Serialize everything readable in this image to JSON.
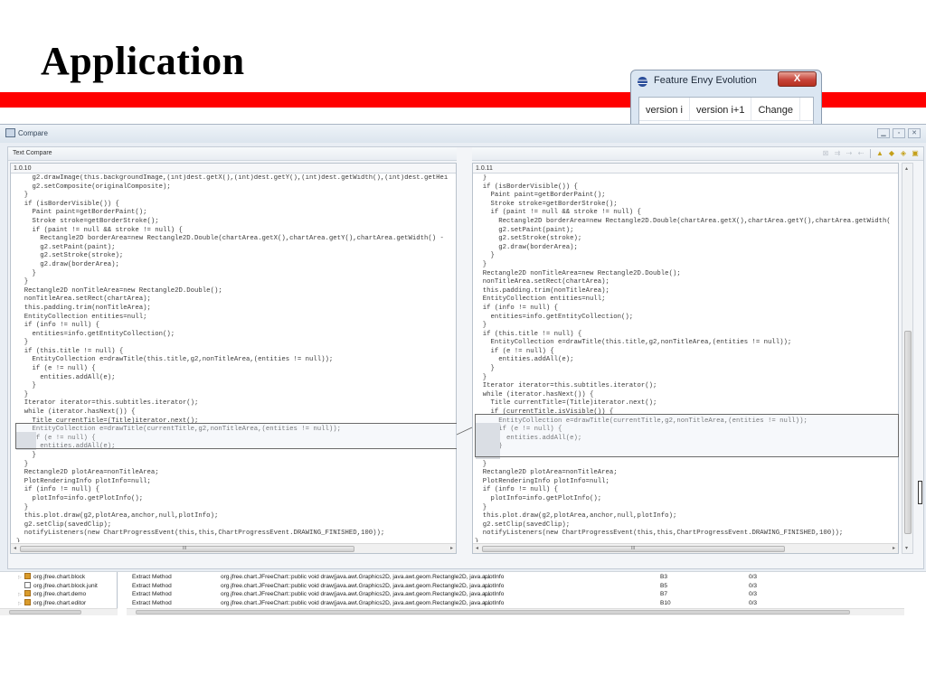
{
  "slide": {
    "title": "Application",
    "accent_color": "#ff0000"
  },
  "feature_envy_window": {
    "title": "Feature Envy Evolution",
    "close_label": "X",
    "columns": [
      "version i",
      "version i+1",
      "Change"
    ]
  },
  "compare_window": {
    "title": "Compare",
    "window_buttons": [
      "minimize",
      "maximize",
      "close"
    ],
    "panel_title": "Text Compare",
    "toolbar_icons": [
      "ignore-whitespace-icon",
      "copy-all-left-icon",
      "copy-right-icon",
      "copy-left-icon",
      "next-difference-icon",
      "previous-difference-icon",
      "next-change-icon",
      "previous-change-icon"
    ],
    "left": {
      "version": "1.0.10",
      "lines": [
        "    g2.drawImage(this.backgroundImage,(int)dest.getX(),(int)dest.getY(),(int)dest.getWidth(),(int)dest.getHei",
        "    g2.setComposite(originalComposite);",
        "  }",
        "  if (isBorderVisible()) {",
        "    Paint paint=getBorderPaint();",
        "    Stroke stroke=getBorderStroke();",
        "    if (paint != null && stroke != null) {",
        "      Rectangle2D borderArea=new Rectangle2D.Double(chartArea.getX(),chartArea.getY(),chartArea.getWidth() -",
        "      g2.setPaint(paint);",
        "      g2.setStroke(stroke);",
        "      g2.draw(borderArea);",
        "    }",
        "  }",
        "  Rectangle2D nonTitleArea=new Rectangle2D.Double();",
        "  nonTitleArea.setRect(chartArea);",
        "  this.padding.trim(nonTitleArea);",
        "  EntityCollection entities=null;",
        "  if (info != null) {",
        "    entities=info.getEntityCollection();",
        "  }",
        "  if (this.title != null) {",
        "    EntityCollection e=drawTitle(this.title,g2,nonTitleArea,(entities != null));",
        "    if (e != null) {",
        "      entities.addAll(e);",
        "    }",
        "  }",
        "  Iterator iterator=this.subtitles.iterator();",
        "  while (iterator.hasNext()) {",
        "    Title currentTitle=(Title)iterator.next();",
        "    EntityCollection e=drawTitle(currentTitle,g2,nonTitleArea,(entities != null));",
        "    if (e != null) {",
        "      entities.addAll(e);",
        "    }",
        "  }",
        "  Rectangle2D plotArea=nonTitleArea;",
        "  PlotRenderingInfo plotInfo=null;",
        "  if (info != null) {",
        "    plotInfo=info.getPlotInfo();",
        "  }",
        "  this.plot.draw(g2,plotArea,anchor,null,plotInfo);",
        "  g2.setClip(savedClip);",
        "  notifyListeners(new ChartProgressEvent(this,this,ChartProgressEvent.DRAWING_FINISHED,100));",
        "}"
      ]
    },
    "right": {
      "version": "1.0.11",
      "lines": [
        "  }",
        "  if (isBorderVisible()) {",
        "    Paint paint=getBorderPaint();",
        "    Stroke stroke=getBorderStroke();",
        "    if (paint != null && stroke != null) {",
        "      Rectangle2D borderArea=new Rectangle2D.Double(chartArea.getX(),chartArea.getY(),chartArea.getWidth(",
        "      g2.setPaint(paint);",
        "      g2.setStroke(stroke);",
        "      g2.draw(borderArea);",
        "    }",
        "  }",
        "  Rectangle2D nonTitleArea=new Rectangle2D.Double();",
        "  nonTitleArea.setRect(chartArea);",
        "  this.padding.trim(nonTitleArea);",
        "  EntityCollection entities=null;",
        "  if (info != null) {",
        "    entities=info.getEntityCollection();",
        "  }",
        "  if (this.title != null) {",
        "    EntityCollection e=drawTitle(this.title,g2,nonTitleArea,(entities != null));",
        "    if (e != null) {",
        "      entities.addAll(e);",
        "    }",
        "  }",
        "  Iterator iterator=this.subtitles.iterator();",
        "  while (iterator.hasNext()) {",
        "    Title currentTitle=(Title)iterator.next();",
        "    if (currentTitle.isVisible()) {",
        "      EntityCollection e=drawTitle(currentTitle,g2,nonTitleArea,(entities != null));",
        "      if (e != null) {",
        "        entities.addAll(e);",
        "      }",
        "    }",
        "  }",
        "  Rectangle2D plotArea=nonTitleArea;",
        "  PlotRenderingInfo plotInfo=null;",
        "  if (info != null) {",
        "    plotInfo=info.getPlotInfo();",
        "  }",
        "  this.plot.draw(g2,plotArea,anchor,null,plotInfo);",
        "  g2.setClip(savedClip);",
        "  notifyListeners(new ChartProgressEvent(this,this,ChartProgressEvent.DRAWING_FINISHED,100));",
        "}"
      ]
    },
    "scroll_grip": "III"
  },
  "package_tree": [
    {
      "label": "org.jfree.chart.block",
      "icon": "package-icon",
      "expandable": true
    },
    {
      "label": "org.jfree.chart.block.junit",
      "icon": "empty-package-icon",
      "expandable": false
    },
    {
      "label": "org.jfree.chart.demo",
      "icon": "package-icon",
      "expandable": true
    },
    {
      "label": "org.jfree.chart.editor",
      "icon": "package-icon",
      "expandable": true
    }
  ],
  "refactoring_table": {
    "rows": [
      {
        "type": "Extract Method",
        "method": "org.jfree.chart.JFreeChart::public void draw(java.awt.Graphics2D, java.awt.geom.Rectangle2D, java.a...",
        "entity": "plotInfo",
        "id": "B3",
        "ratio": "0/3"
      },
      {
        "type": "Extract Method",
        "method": "org.jfree.chart.JFreeChart::public void draw(java.awt.Graphics2D, java.awt.geom.Rectangle2D, java.a...",
        "entity": "plotInfo",
        "id": "B5",
        "ratio": "0/3"
      },
      {
        "type": "Extract Method",
        "method": "org.jfree.chart.JFreeChart::public void draw(java.awt.Graphics2D, java.awt.geom.Rectangle2D, java.a...",
        "entity": "plotInfo",
        "id": "B7",
        "ratio": "0/3"
      },
      {
        "type": "Extract Method",
        "method": "org.jfree.chart.JFreeChart::public void draw(java.awt.Graphics2D, java.awt.geom.Rectangle2D, java.a...",
        "entity": "plotInfo",
        "id": "B10",
        "ratio": "0/3"
      }
    ]
  }
}
